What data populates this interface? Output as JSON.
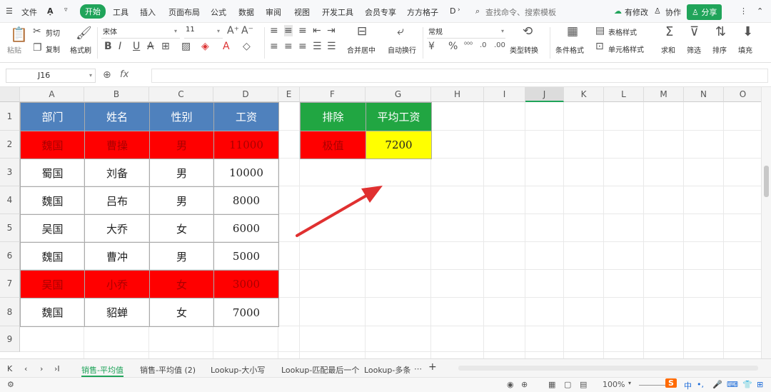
{
  "menubar": {
    "file": "文件",
    "tabs": [
      "开始",
      "工具",
      "插入",
      "页面布局",
      "公式",
      "数据",
      "审阅",
      "视图",
      "开发工具",
      "会员专享",
      "方方格子",
      "D"
    ],
    "search": "查找命令、搜索模板",
    "modified": "有修改",
    "collab": "协作",
    "share": "分享"
  },
  "ribbon": {
    "paste": "粘贴",
    "cut": "剪切",
    "copy": "复制",
    "format_painter": "格式刷",
    "font_name": "宋体",
    "font_size": "11",
    "merge": "合并居中",
    "wrap": "自动换行",
    "number_format": "常规",
    "type_convert": "类型转换",
    "cond_format": "条件格式",
    "table_style": "表格样式",
    "cell_style": "单元格样式",
    "sum": "求和",
    "filter": "筛选",
    "sort": "排序",
    "fill": "填充"
  },
  "formula_bar": {
    "cell_ref": "J16",
    "fx": "fx",
    "value": ""
  },
  "columns": [
    "A",
    "B",
    "C",
    "D",
    "E",
    "F",
    "G",
    "H",
    "I",
    "J",
    "K",
    "L",
    "M",
    "N",
    "O"
  ],
  "rows": [
    "1",
    "2",
    "3",
    "4",
    "5",
    "6",
    "7",
    "8",
    "9"
  ],
  "table": {
    "headers": [
      "部门",
      "姓名",
      "性别",
      "工资"
    ],
    "rows": [
      [
        "魏国",
        "曹操",
        "男",
        "11000"
      ],
      [
        "蜀国",
        "刘备",
        "男",
        "10000"
      ],
      [
        "魏国",
        "吕布",
        "男",
        "8000"
      ],
      [
        "吴国",
        "大乔",
        "女",
        "6000"
      ],
      [
        "魏国",
        "曹冲",
        "男",
        "5000"
      ],
      [
        "吴国",
        "小乔",
        "女",
        "3000"
      ],
      [
        "魏国",
        "貂蝉",
        "女",
        "7000"
      ]
    ]
  },
  "side": {
    "h1": "排除",
    "h2": "平均工资",
    "v1": "极值",
    "v2": "7200"
  },
  "sheets": [
    "销售-平均值",
    "销售-平均值 (2)",
    "Lookup-大小写",
    "Lookup-匹配最后一个",
    "Lookup-多条"
  ],
  "status": {
    "zoom": "100%",
    "ime": "中"
  },
  "colors": {
    "accent": "#20a45a",
    "header_blue": "#4f81bd",
    "highlight_red": "#ff0000",
    "green": "#21a642",
    "yellow": "#ffff00",
    "arrow": "#e03030"
  }
}
